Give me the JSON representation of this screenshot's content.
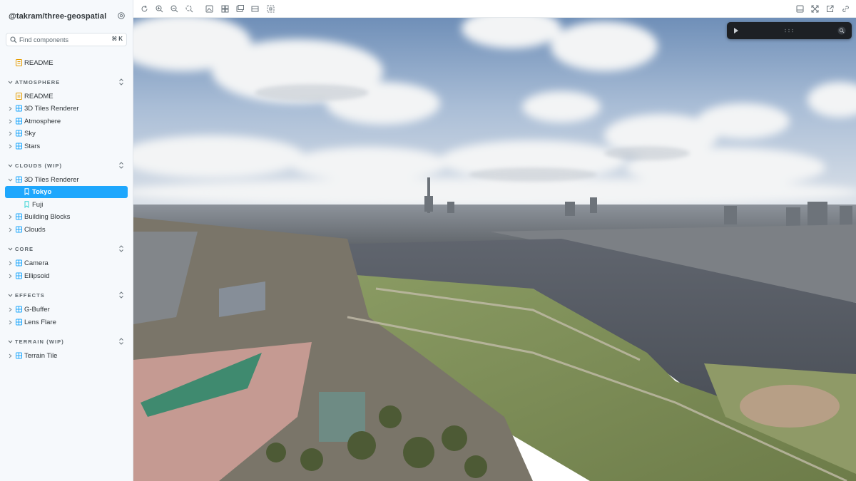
{
  "sidebar": {
    "brand": "@takram/three-geospatial",
    "search": {
      "placeholder": "Find components",
      "shortcut": "⌘ K"
    },
    "readme": "README",
    "sections": {
      "atmosphere": {
        "title": "ATMOSPHERE",
        "items": [
          "README",
          "3D Tiles Renderer",
          "Atmosphere",
          "Sky",
          "Stars"
        ]
      },
      "clouds": {
        "title": "CLOUDS (WIP)",
        "items": [
          "3D Tiles Renderer",
          "Tokyo",
          "Fuji",
          "Building Blocks",
          "Clouds"
        ]
      },
      "core": {
        "title": "CORE",
        "items": [
          "Camera",
          "Ellipsoid"
        ]
      },
      "effects": {
        "title": "EFFECTS",
        "items": [
          "G-Buffer",
          "Lens Flare"
        ]
      },
      "terrain": {
        "title": "TERRAIN (WIP)",
        "items": [
          "Terrain Tile"
        ]
      }
    },
    "selected_story": "Tokyo"
  },
  "toolbar": {
    "left_icons": [
      "reload-icon",
      "zoom-in-icon",
      "zoom-out-icon",
      "zoom-reset-icon",
      "background-icon",
      "grid-icon",
      "viewport-icon",
      "measure-icon",
      "outline-icon"
    ],
    "right_icons": [
      "sidebar-toggle-icon",
      "fullscreen-icon",
      "open-new-tab-icon",
      "copy-link-icon"
    ]
  },
  "colors": {
    "accent": "#1ea7fd",
    "sidebar_bg": "#f6f9fc",
    "panel_dark": "#1d2024",
    "component_icon": "#1ea7fd",
    "doc_icon": "#e69d00",
    "story_icon": "#37d5d3"
  }
}
